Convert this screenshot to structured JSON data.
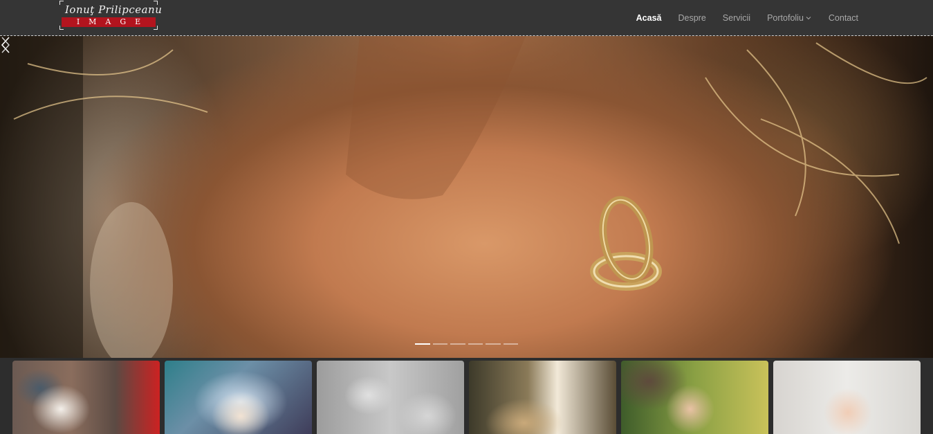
{
  "logo": {
    "script_text": "Ionuţ Prilipceanu",
    "band_text": "IMAGE"
  },
  "nav": {
    "items": [
      {
        "label": "Acasă",
        "active": true
      },
      {
        "label": "Despre",
        "active": false
      },
      {
        "label": "Servicii",
        "active": false
      },
      {
        "label": "Portofoliu",
        "active": false,
        "dropdown": true
      },
      {
        "label": "Contact",
        "active": false
      }
    ]
  },
  "slider": {
    "icons": {
      "prev": "chevron-left-icon",
      "next": "chevron-right-icon"
    },
    "slide_count": 6,
    "active_index": 0
  },
  "thumbnails": [
    {
      "subject": "baby-in-blanket"
    },
    {
      "subject": "baby-in-blue-blanket"
    },
    {
      "subject": "baby-black-and-white"
    },
    {
      "subject": "church-gate"
    },
    {
      "subject": "baby-held-by-father"
    },
    {
      "subject": "baby-portrait"
    }
  ],
  "colors": {
    "header_bg": "#353535",
    "nav_active": "#ffffff",
    "nav_inactive": "#a9a9a9",
    "logo_band": "#b3141e"
  }
}
